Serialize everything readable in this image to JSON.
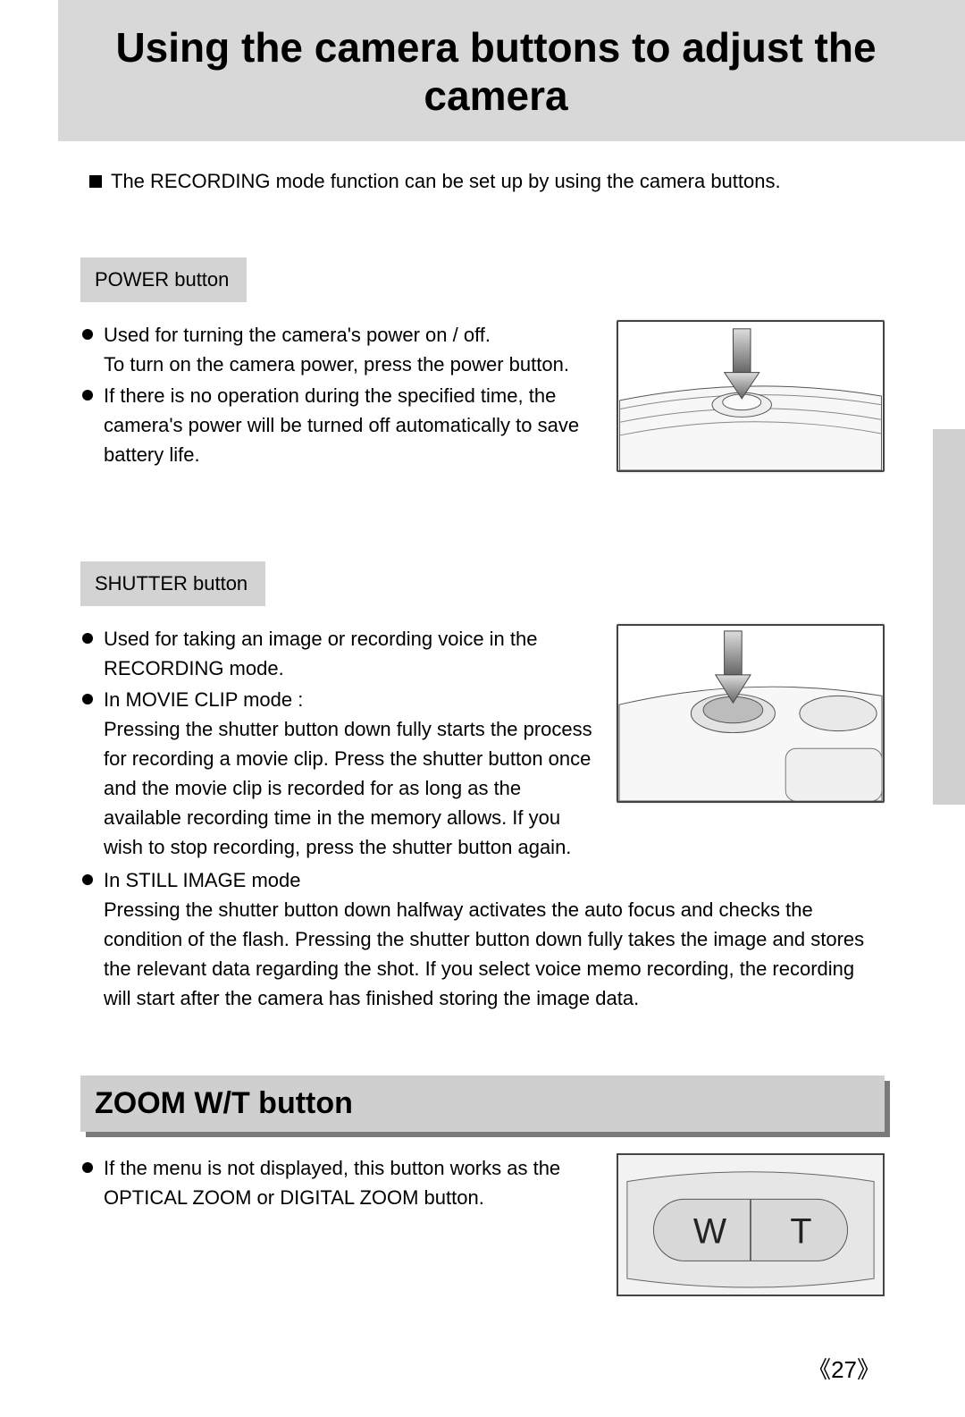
{
  "title": "Using the camera buttons to adjust the camera",
  "intro": "The RECORDING mode function can be set up by using the camera buttons.",
  "power": {
    "label": "POWER button",
    "bullet1_line1": "Used for turning the camera's power on / off.",
    "bullet1_line2": "To turn on the camera power, press the power button.",
    "bullet2": "If there is no operation during the specified time, the camera's power will be turned off automatically to save battery life."
  },
  "shutter": {
    "label": "SHUTTER button",
    "bullet1": "Used for taking an image or recording voice in the RECORDING mode.",
    "bullet2_head": "In MOVIE CLIP mode :",
    "bullet2_body": "Pressing the shutter button down fully starts the process for recording a movie clip. Press the shutter button once and the movie clip is recorded for as long as the available recording time in the memory allows. If you wish to stop recording, press the shutter button again.",
    "bullet3_head": "In STILL IMAGE mode",
    "bullet3_body": "Pressing the shutter button down halfway activates the auto focus and checks the condition of the flash. Pressing the shutter button down fully takes the image and stores the relevant data regarding the shot. If you select voice memo recording, the recording will start after the camera has finished storing the image data."
  },
  "zoom": {
    "heading": "ZOOM W/T button",
    "bullet1": "If the menu is not displayed, this button works as the OPTICAL ZOOM or DIGITAL ZOOM button.",
    "w_label": "W",
    "t_label": "T"
  },
  "page_number": "27"
}
